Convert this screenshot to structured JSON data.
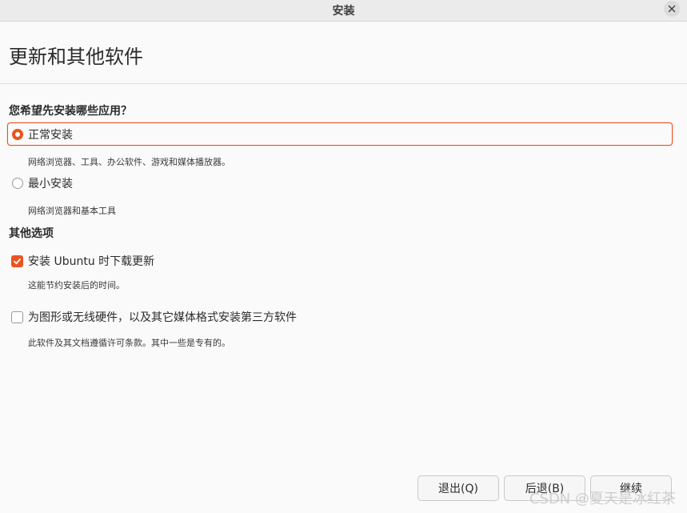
{
  "window": {
    "title": "安装"
  },
  "page": {
    "title": "更新和其他软件"
  },
  "install_type": {
    "heading": "您希望先安装哪些应用？",
    "options": [
      {
        "label": "正常安装",
        "description": "网络浏览器、工具、办公软件、游戏和媒体播放器。",
        "selected": true
      },
      {
        "label": "最小安装",
        "description": "网络浏览器和基本工具",
        "selected": false
      }
    ]
  },
  "other_options": {
    "heading": "其他选项",
    "items": [
      {
        "label": "安装 Ubuntu 时下载更新",
        "description": "这能节约安装后的时间。",
        "checked": true
      },
      {
        "label": "为图形或无线硬件，以及其它媒体格式安装第三方软件",
        "description": "此软件及其文档遵循许可条款。其中一些是专有的。",
        "checked": false
      }
    ]
  },
  "buttons": {
    "quit": "退出(Q)",
    "back": "后退(B)",
    "continue": "继续"
  },
  "watermark": "CSDN @夏天是冰红茶",
  "colors": {
    "accent": "#e95420",
    "background": "#fafafa",
    "titlebar": "#ebebeb"
  },
  "icons": {
    "close": "close-icon",
    "check": "check-icon"
  }
}
